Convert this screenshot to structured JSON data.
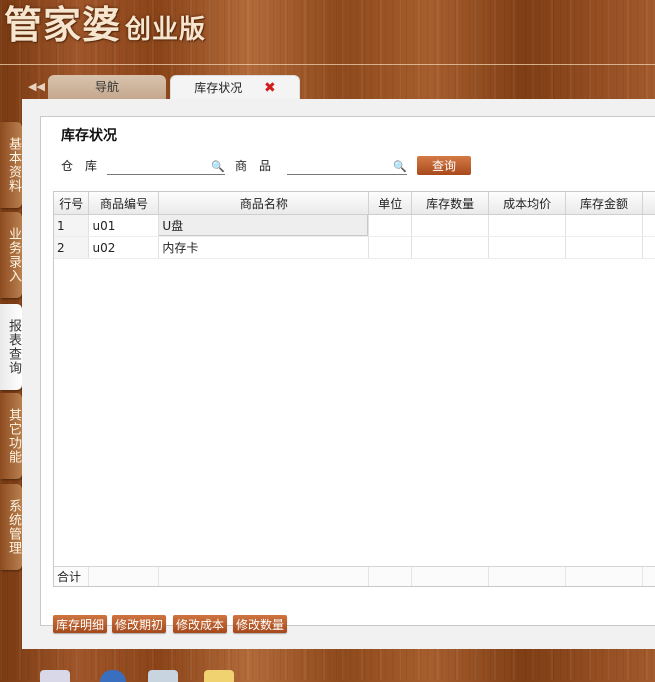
{
  "app": {
    "logo_main": "管家婆",
    "logo_sub": "创业版"
  },
  "tabs": [
    {
      "label": "导航"
    },
    {
      "label": "库存状况",
      "close": "✖"
    }
  ],
  "tab_scroll_icon": "double-left-arrow",
  "sidebar": [
    {
      "label": "基本资料"
    },
    {
      "label": "业务录入"
    },
    {
      "label": "报表查询"
    },
    {
      "label": "其它功能"
    },
    {
      "label": "系统管理"
    }
  ],
  "page": {
    "title": "库存状况",
    "warehouse_label": "仓　库",
    "warehouse_value": "",
    "product_label": "商　品",
    "product_value": "",
    "query_button": "查询"
  },
  "table": {
    "columns": [
      "行号",
      "商品编号",
      "商品名称",
      "单位",
      "库存数量",
      "成本均价",
      "库存金额"
    ],
    "rows": [
      [
        "1",
        "u01",
        "U盘",
        "",
        "",
        "",
        ""
      ],
      [
        "2",
        "u02",
        "内存卡",
        "",
        "",
        "",
        ""
      ]
    ],
    "total_label": "合计"
  },
  "actions": [
    "库存明细",
    "修改期初",
    "修改成本",
    "修改数量"
  ],
  "colors": {
    "accent": "#b8582a",
    "wood": "#8a4418",
    "close": "#d21c1c"
  }
}
